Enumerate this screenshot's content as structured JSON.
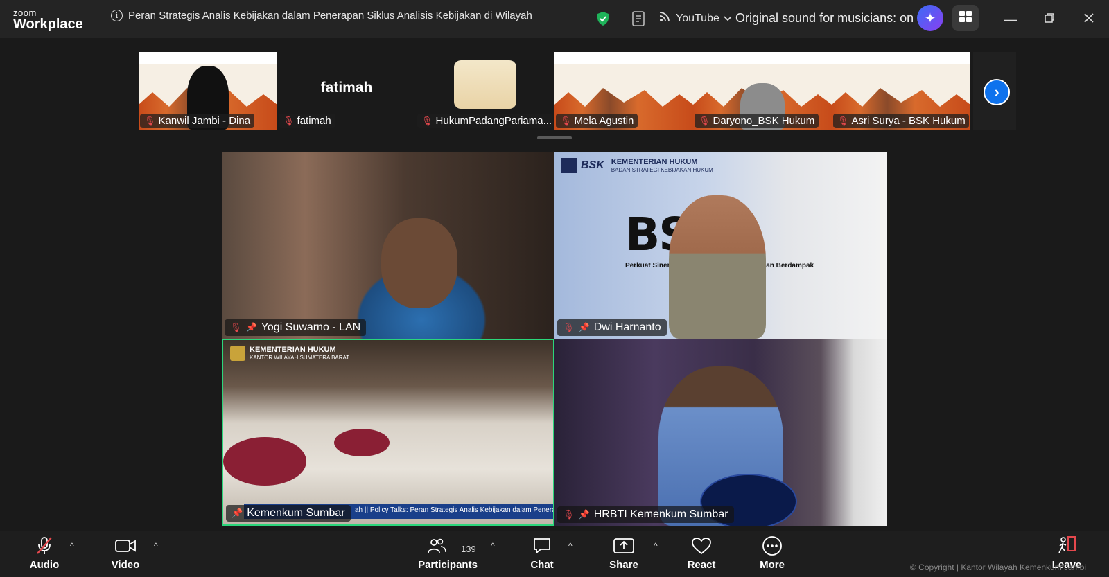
{
  "app": {
    "logo_top": "zoom",
    "logo_bottom": "Workplace"
  },
  "meeting": {
    "title": "Peran Strategis Analis Kebijakan dalam Penerapan Siklus Analisis Kebijakan di Wilayah"
  },
  "titlebar": {
    "stream_label": "YouTube",
    "sound_status": "Original sound for musicians: on"
  },
  "strip": {
    "thumbs": [
      {
        "name": "Kanwil Jambi - Dina"
      },
      {
        "name": "fatimah",
        "display": "fatimah"
      },
      {
        "name": "HukumPadangPariama..."
      },
      {
        "name": "Mela Agustin"
      },
      {
        "name": "Daryono_BSK Hukum"
      },
      {
        "name": "Asri Surya - BSK Hukum"
      }
    ]
  },
  "tiles": [
    {
      "name": "Yogi Suwarno - LAN"
    },
    {
      "name": "Dwi Harnanto",
      "header_title": "KEMENTERIAN HUKUM",
      "header_sub": "BADAN STRATEGI KEBIJAKAN HUKUM",
      "tagline": "Perkuat Sinergi, Wujudkan ... Berkualitas dan Berdampak"
    },
    {
      "name": "Kemenkum Sumbar",
      "header_title": "KEMENTERIAN HUKUM",
      "header_sub": "KANTOR WILAYAH SUMATERA BARAT",
      "ticker": "ah || Policy Talks: Peran Strategis Analis Kebijakan dalam Penerap"
    },
    {
      "name": "HRBTI Kemenkum Sumbar"
    }
  ],
  "toolbar": {
    "audio": "Audio",
    "video": "Video",
    "participants": "Participants",
    "participants_count": "139",
    "chat": "Chat",
    "share": "Share",
    "react": "React",
    "more": "More",
    "leave": "Leave"
  },
  "footer": {
    "copyright": "© Copyright | Kantor Wilayah Kemenkum Jambi"
  },
  "colors": {
    "accent_blue": "#0e72ed",
    "active_speaker": "#2bd67b",
    "muted_red": "#e5484d",
    "shield_green": "#1fb35a"
  }
}
